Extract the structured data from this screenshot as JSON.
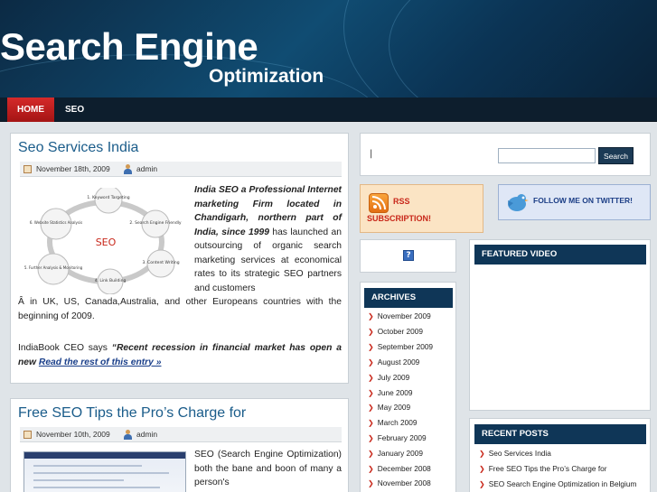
{
  "header": {
    "title": "Search Engine",
    "subtitle": "Optimization"
  },
  "nav": {
    "items": [
      "HOME",
      "SEO"
    ]
  },
  "posts": [
    {
      "title": "Seo Services India",
      "date": "November 18th, 2009",
      "author": "admin",
      "intro_bold": "India SEO a Professional Internet marketing Firm located in Chandigarh, northern part of India, since 1999",
      "intro_rest": " has launched an outsourcing of organic search marketing services at economical rates to its strategic SEO partners and customers",
      "continued": "Â  in UK, US, Canada,Australia, and other Europeans countries with the beginning of 2009.",
      "quote_prefix": "IndiaBook CEO says ",
      "quote_bold": "“Recent recession in financial market has open a new ",
      "read_more": "Read the rest of this entry »",
      "diagram": {
        "center": "SEO",
        "steps": [
          "1. Keyword Targeting",
          "2. Search Engine Friendly",
          "3. Content Writing",
          "4. Link Building",
          "5. Further Analysis & Monitoring",
          "6. Website Statistics Analysis"
        ]
      }
    },
    {
      "title": "Free SEO Tips the Pro’s Charge for",
      "date": "November 10th, 2009",
      "author": "admin",
      "intro": "SEO (Search Engine Optimization) both the bane and boon of many a person's"
    }
  ],
  "search": {
    "pipe": "|",
    "button": "Search",
    "value": ""
  },
  "rss": {
    "line1": "RSS",
    "line2": "SUBSCRIPTION!"
  },
  "twitter": {
    "label": "FOLLOW ME ON TWITTER!"
  },
  "badge": {
    "glyph": "?"
  },
  "archives": {
    "title": "ARCHIVES",
    "items": [
      "November 2009",
      "October 2009",
      "September 2009",
      "August 2009",
      "July 2009",
      "June 2009",
      "May 2009",
      "March 2009",
      "February 2009",
      "January 2009",
      "December 2008",
      "November 2008"
    ]
  },
  "featured_video": {
    "title": "FEATURED VIDEO"
  },
  "recent_posts": {
    "title": "RECENT POSTS",
    "items": [
      "Seo Services India",
      "Free SEO Tips the Pro’s Charge for",
      "SEO Search Engine Optimization in Belgium"
    ]
  },
  "colors": {
    "header": "#104c72",
    "nav": "#0d1e2d",
    "accent_red": "#c8271a",
    "link": "#1a5c8a",
    "widget_title": "#0f3657"
  },
  "icons": [
    "calendar-icon",
    "user-icon",
    "rss-icon",
    "twitter-bird-icon",
    "arrow-bullet-icon",
    "question-mark-icon"
  ]
}
